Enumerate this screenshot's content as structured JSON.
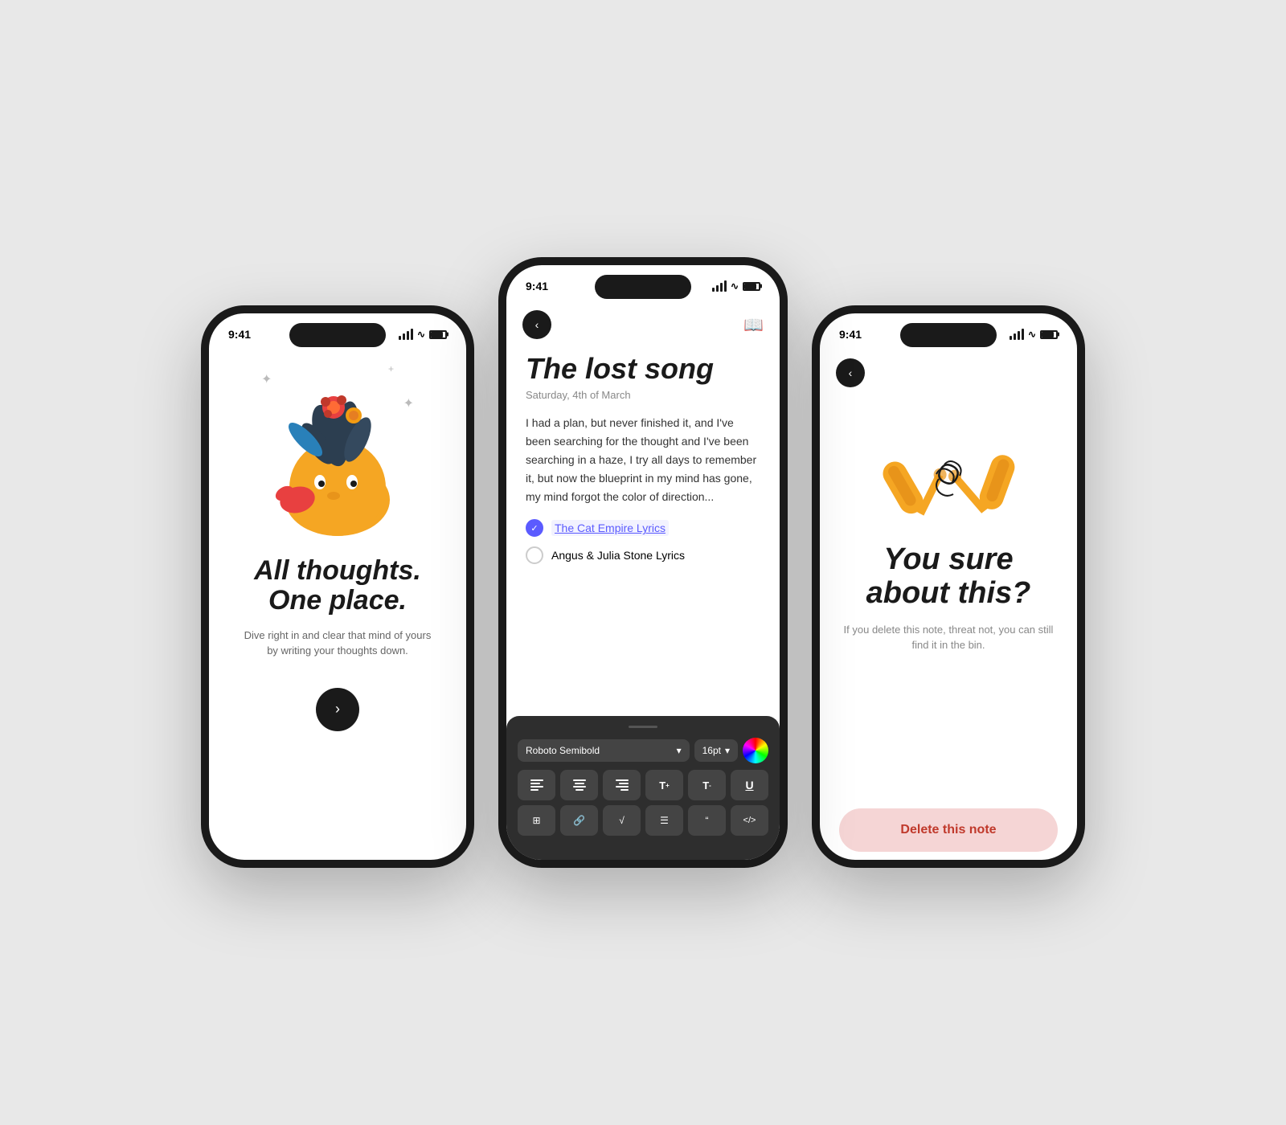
{
  "background": "#e8e8e8",
  "phones": {
    "left": {
      "status_time": "9:41",
      "tagline": "All thoughts. One place.",
      "subtitle": "Dive right in and clear that mind of yours by writing your thoughts down.",
      "next_btn_label": "›"
    },
    "center": {
      "status_time": "9:41",
      "note_title": "The lost song",
      "note_date": "Saturday, 4th of March",
      "note_body": "I had a plan, but never finished it, and I've been searching for the thought and I've been searching in a haze, I try all days to remember it, but now the blueprint in my mind has gone, my mind forgot the color of direction...",
      "checklist": [
        {
          "label": "The Cat Empire Lyrics",
          "checked": true
        },
        {
          "label": "Angus & Julia Stone Lyrics",
          "checked": false
        }
      ],
      "toolbar": {
        "font": "Roboto Semibold",
        "size": "16pt",
        "buttons_row2": [
          "≡",
          "≡",
          "≡",
          "T↑",
          "T↓",
          "U"
        ],
        "buttons_row3": [
          "⊞",
          "⊟",
          "√",
          "≡",
          "❝",
          "</>"
        ]
      }
    },
    "right": {
      "status_time": "9:41",
      "confirm_title": "You sure about this?",
      "confirm_subtitle": "If you delete this note, threat not, you can still find it in the bin.",
      "delete_label": "Delete this note"
    }
  }
}
